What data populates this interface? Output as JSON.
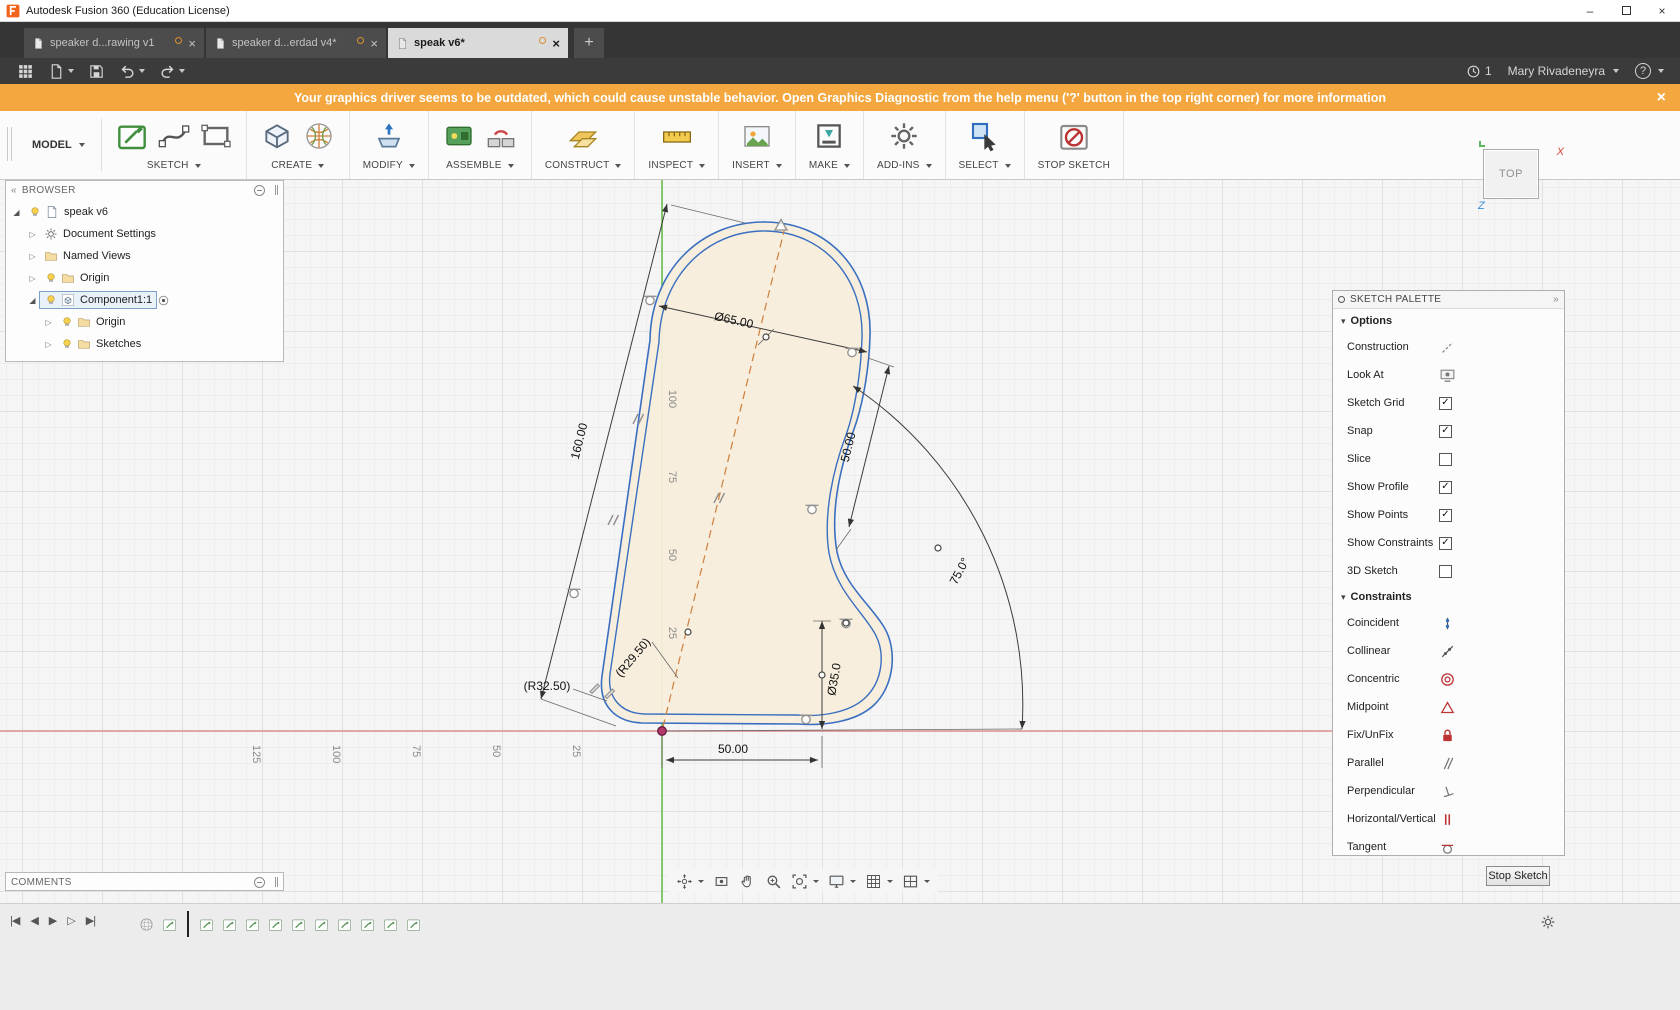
{
  "window": {
    "title": "Autodesk Fusion 360 (Education License)"
  },
  "tabbar": {
    "tabs": [
      {
        "label": "speaker d...rawing v1",
        "active": false
      },
      {
        "label": "speaker d...erdad v4*",
        "active": false
      },
      {
        "label": "speak v6*",
        "active": true
      }
    ],
    "new_tab_label": "+"
  },
  "appbar": {
    "left_icons": [
      {
        "icon": "app-grid-icon",
        "dropdown": false
      },
      {
        "icon": "file-icon",
        "dropdown": true
      },
      {
        "icon": "save-icon",
        "dropdown": false
      },
      {
        "icon": "undo-icon",
        "dropdown": true
      },
      {
        "icon": "redo-icon",
        "dropdown": true
      }
    ],
    "notification_count": "1",
    "user_name": "Mary Rivadeneyra",
    "help_label": "?"
  },
  "warning_banner": {
    "message": "Your graphics driver seems to be outdated, which could cause unstable behavior. Open Graphics Diagnostic from the help menu ('?' button in the top right corner) for more information"
  },
  "ribbon": {
    "workspace_label": "MODEL",
    "groups": [
      {
        "label": "SKETCH",
        "dropdown": true,
        "icons": [
          "create-sketch-icon",
          "spline-icon",
          "rectangle-icon"
        ]
      },
      {
        "label": "CREATE",
        "dropdown": true,
        "icons": [
          "box-icon",
          "form-sphere-icon"
        ]
      },
      {
        "label": "MODIFY",
        "dropdown": true,
        "icons": [
          "press-pull-icon"
        ]
      },
      {
        "label": "ASSEMBLE",
        "dropdown": true,
        "icons": [
          "pcb-icon",
          "joint-icon"
        ]
      },
      {
        "label": "CONSTRUCT",
        "dropdown": true,
        "icons": [
          "plane-icon"
        ]
      },
      {
        "label": "INSPECT",
        "dropdown": true,
        "icons": [
          "measure-icon"
        ]
      },
      {
        "label": "INSERT",
        "dropdown": true,
        "icons": [
          "insert-image-icon"
        ]
      },
      {
        "label": "MAKE",
        "dropdown": true,
        "icons": [
          "make-icon"
        ]
      },
      {
        "label": "ADD-INS",
        "dropdown": true,
        "icons": [
          "addins-gear-icon"
        ]
      },
      {
        "label": "SELECT",
        "dropdown": true,
        "icons": [
          "select-cursor-icon"
        ]
      },
      {
        "label": "STOP SKETCH",
        "dropdown": false,
        "icons": [
          "stop-sketch-icon"
        ]
      }
    ]
  },
  "browser": {
    "header": "BROWSER",
    "items": [
      {
        "label": "speak v6",
        "depth": 0,
        "expander": "expanded",
        "icons": [
          "bulb-icon",
          "document-icon"
        ],
        "selected": false,
        "radio": false
      },
      {
        "label": "Document Settings",
        "depth": 1,
        "expander": "collapsed",
        "icons": [
          "gear-icon"
        ],
        "selected": false,
        "radio": false
      },
      {
        "label": "Named Views",
        "depth": 1,
        "expander": "collapsed",
        "icons": [
          "folder-icon"
        ],
        "selected": false,
        "radio": false
      },
      {
        "label": "Origin",
        "depth": 1,
        "expander": "collapsed",
        "icons": [
          "bulb-icon",
          "folder-icon"
        ],
        "selected": false,
        "radio": false
      },
      {
        "label": "Component1:1",
        "depth": 1,
        "expander": "expanded",
        "icons": [
          "bulb-icon",
          "component-icon"
        ],
        "selected": true,
        "radio": true
      },
      {
        "label": "Origin",
        "depth": 2,
        "expander": "collapsed",
        "icons": [
          "bulb-icon",
          "folder-icon"
        ],
        "selected": false,
        "radio": false
      },
      {
        "label": "Sketches",
        "depth": 2,
        "expander": "collapsed",
        "icons": [
          "bulb-icon",
          "folder-icon"
        ],
        "selected": false,
        "radio": false
      }
    ]
  },
  "viewcube": {
    "face_label": "TOP",
    "axis_x_label": "X",
    "axis_z_label": "Z"
  },
  "sketch": {
    "dim_diameter_top": "Ø65.00",
    "dim_height": "160.00",
    "dim_right": "50.00",
    "dim_radius_corner": "(R32.50)",
    "dim_radius_inner": "(R29.50)",
    "dim_diameter_bottom": "Ø35.0",
    "dim_width_bottom": "50.00",
    "dim_angle": "75.0°",
    "x_axis_ticks": [
      "125",
      "100",
      "75",
      "50",
      "25"
    ],
    "y_axis_ticks": [
      "100",
      "75",
      "50",
      "25"
    ]
  },
  "sketch_palette": {
    "header": "SKETCH PALETTE",
    "options_section_label": "Options",
    "options": [
      {
        "label": "Construction",
        "control": "icon",
        "icon": "construction-line-icon"
      },
      {
        "label": "Look At",
        "control": "icon",
        "icon": "look-at-icon"
      },
      {
        "label": "Sketch Grid",
        "control": "checkbox",
        "checked": true
      },
      {
        "label": "Snap",
        "control": "checkbox",
        "checked": true
      },
      {
        "label": "Slice",
        "control": "checkbox",
        "checked": false
      },
      {
        "label": "Show Profile",
        "control": "checkbox",
        "checked": true
      },
      {
        "label": "Show Points",
        "control": "checkbox",
        "checked": true
      },
      {
        "label": "Show Constraints",
        "control": "checkbox",
        "checked": true
      },
      {
        "label": "3D Sketch",
        "control": "checkbox",
        "checked": false
      }
    ],
    "constraints_section_label": "Constraints",
    "constraints": [
      {
        "label": "Coincident",
        "icon": "coincident-icon"
      },
      {
        "label": "Collinear",
        "icon": "collinear-icon"
      },
      {
        "label": "Concentric",
        "icon": "concentric-icon"
      },
      {
        "label": "Midpoint",
        "icon": "midpoint-icon"
      },
      {
        "label": "Fix/UnFix",
        "icon": "lock-icon"
      },
      {
        "label": "Parallel",
        "icon": "parallel-icon"
      },
      {
        "label": "Perpendicular",
        "icon": "perpendicular-icon"
      },
      {
        "label": "Horizontal/Vertical",
        "icon": "horizontal-vertical-icon"
      },
      {
        "label": "Tangent",
        "icon": "tangent-icon"
      }
    ],
    "stop_sketch_button": "Stop Sketch"
  },
  "comments": {
    "header": "COMMENTS"
  },
  "navbar": {
    "icons": [
      {
        "icon": "orbit-icon",
        "dropdown": true
      },
      {
        "icon": "look-at-box-icon",
        "dropdown": false
      },
      {
        "icon": "pan-icon",
        "dropdown": false
      },
      {
        "icon": "zoom-icon",
        "dropdown": false
      },
      {
        "icon": "fit-icon",
        "dropdown": true
      },
      {
        "icon": "display-settings-icon",
        "dropdown": true
      },
      {
        "icon": "grid-settings-icon",
        "dropdown": true
      },
      {
        "icon": "viewports-icon",
        "dropdown": true
      }
    ]
  },
  "timeline": {
    "controls": [
      "skip-start-icon",
      "step-back-icon",
      "play-icon",
      "step-forward-icon",
      "skip-end-icon"
    ],
    "features": [
      "sphere-feature-icon",
      "sketch-feature-icon",
      "position-marker",
      "sketch-feature-icon",
      "sketch-feature-icon",
      "sketch-feature-icon",
      "sketch-feature-icon",
      "sketch-feature-icon",
      "sketch-feature-icon",
      "sketch-feature-icon",
      "sketch-feature-icon",
      "sketch-feature-icon",
      "sketch-feature-icon"
    ]
  }
}
